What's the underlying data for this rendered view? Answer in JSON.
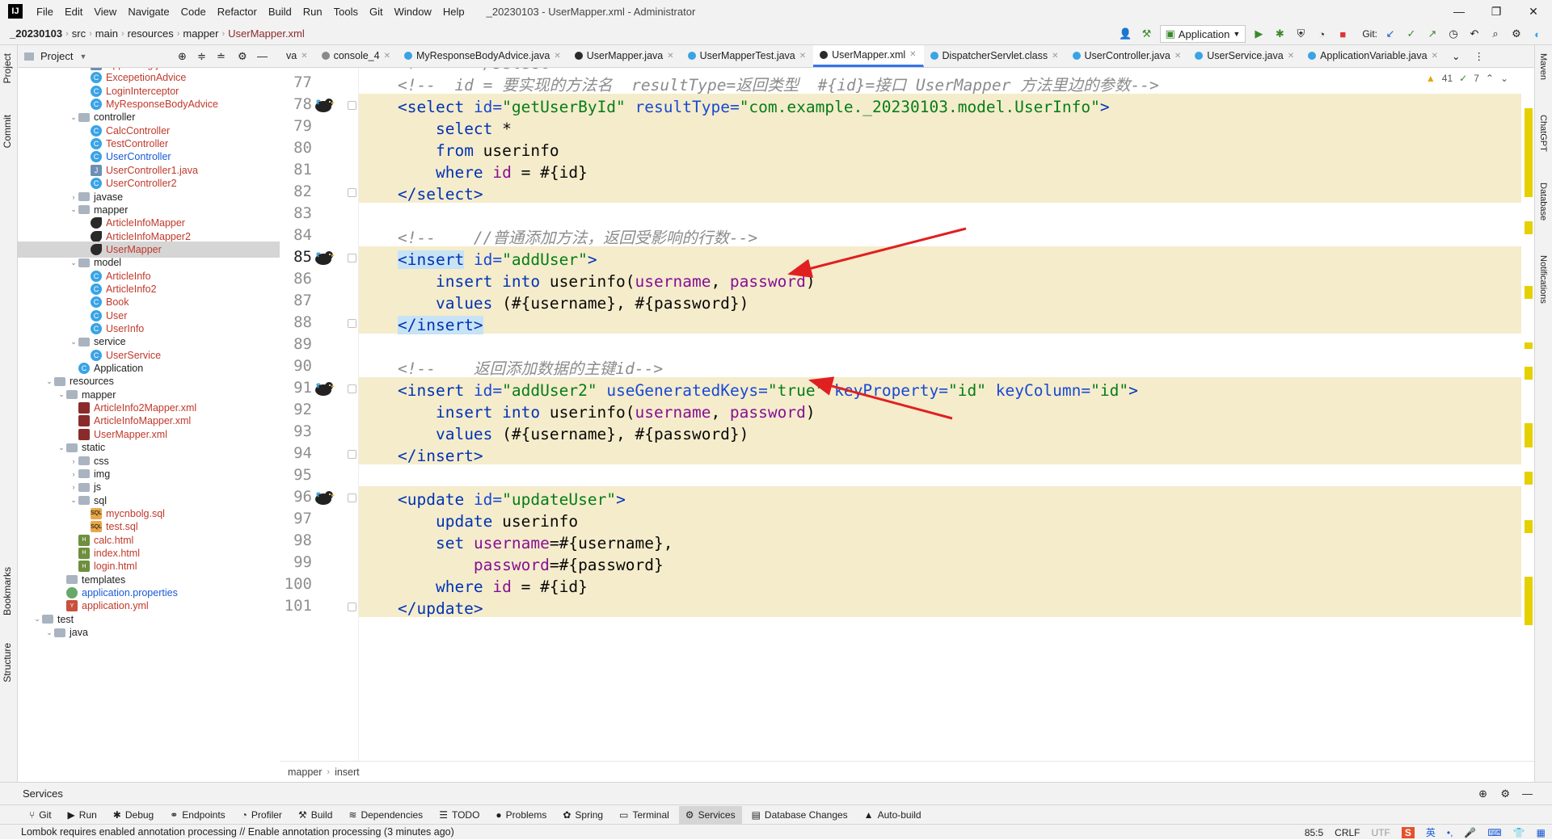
{
  "menubar": {
    "items": [
      "File",
      "Edit",
      "View",
      "Navigate",
      "Code",
      "Refactor",
      "Build",
      "Run",
      "Tools",
      "Git",
      "Window",
      "Help"
    ],
    "title": "_20230103 - UserMapper.xml - Administrator"
  },
  "breadcrumb": [
    "_20230103",
    "src",
    "main",
    "resources",
    "mapper",
    "UserMapper.xml"
  ],
  "toolbar": {
    "run_config": "Application",
    "git_label": "Git:"
  },
  "left_strip": {
    "project": "Project",
    "commit": "Commit",
    "bookmarks": "Bookmarks",
    "structure": "Structure"
  },
  "right_strip": {
    "maven": "Maven",
    "chatgpt": "ChatGPT",
    "database": "Database",
    "notifications": "Notifications"
  },
  "project_panel": {
    "title": "Project"
  },
  "tree": [
    {
      "label": "AppConfig.java",
      "icon": "jfile",
      "indent": 4,
      "color": "red"
    },
    {
      "label": "ExcepetionAdvice",
      "icon": "cls",
      "indent": 4,
      "color": "red"
    },
    {
      "label": "LoginInterceptor",
      "icon": "cls",
      "indent": 4,
      "color": "red"
    },
    {
      "label": "MyResponseBodyAdvice",
      "icon": "cls",
      "indent": 4,
      "color": "red"
    },
    {
      "label": "controller",
      "icon": "folder",
      "indent": 3,
      "chev": "v"
    },
    {
      "label": "CalcController",
      "icon": "cls",
      "indent": 4,
      "color": "red"
    },
    {
      "label": "TestController",
      "icon": "cls",
      "indent": 4,
      "color": "red"
    },
    {
      "label": "UserController",
      "icon": "cls",
      "indent": 4,
      "color": "blue"
    },
    {
      "label": "UserController1.java",
      "icon": "jfile",
      "indent": 4,
      "color": "red"
    },
    {
      "label": "UserController2",
      "icon": "cls",
      "indent": 4,
      "color": "red"
    },
    {
      "label": "javase",
      "icon": "folder",
      "indent": 3,
      "chev": ">"
    },
    {
      "label": "mapper",
      "icon": "folder",
      "indent": 3,
      "chev": "v"
    },
    {
      "label": "ArticleInfoMapper",
      "icon": "bird",
      "indent": 4,
      "color": "red"
    },
    {
      "label": "ArticleInfoMapper2",
      "icon": "bird",
      "indent": 4,
      "color": "red"
    },
    {
      "label": "UserMapper",
      "icon": "bird",
      "indent": 4,
      "color": "red",
      "selected": true
    },
    {
      "label": "model",
      "icon": "folder",
      "indent": 3,
      "chev": "v"
    },
    {
      "label": "ArticleInfo",
      "icon": "cls",
      "indent": 4,
      "color": "red"
    },
    {
      "label": "ArticleInfo2",
      "icon": "cls",
      "indent": 4,
      "color": "red"
    },
    {
      "label": "Book",
      "icon": "cls",
      "indent": 4,
      "color": "red"
    },
    {
      "label": "User",
      "icon": "cls",
      "indent": 4,
      "color": "red"
    },
    {
      "label": "UserInfo",
      "icon": "cls",
      "indent": 4,
      "color": "red"
    },
    {
      "label": "service",
      "icon": "folder",
      "indent": 3,
      "chev": "v"
    },
    {
      "label": "UserService",
      "icon": "cls",
      "indent": 4,
      "color": "red"
    },
    {
      "label": "Application",
      "icon": "app",
      "indent": 3
    },
    {
      "label": "resources",
      "icon": "folder",
      "indent": 1,
      "chev": "v"
    },
    {
      "label": "mapper",
      "icon": "folder",
      "indent": 2,
      "chev": "v"
    },
    {
      "label": "ArticleInfo2Mapper.xml",
      "icon": "xml",
      "indent": 3,
      "color": "red"
    },
    {
      "label": "ArticleInfoMapper.xml",
      "icon": "xml",
      "indent": 3,
      "color": "red"
    },
    {
      "label": "UserMapper.xml",
      "icon": "xml",
      "indent": 3,
      "color": "red"
    },
    {
      "label": "static",
      "icon": "folder",
      "indent": 2,
      "chev": "v"
    },
    {
      "label": "css",
      "icon": "folder",
      "indent": 3,
      "chev": ">"
    },
    {
      "label": "img",
      "icon": "folder",
      "indent": 3,
      "chev": ">"
    },
    {
      "label": "js",
      "icon": "folder",
      "indent": 3,
      "chev": ">"
    },
    {
      "label": "sql",
      "icon": "folder",
      "indent": 3,
      "chev": "v"
    },
    {
      "label": "mycnbolg.sql",
      "icon": "sql",
      "indent": 4,
      "color": "red"
    },
    {
      "label": "test.sql",
      "icon": "sql",
      "indent": 4,
      "color": "red"
    },
    {
      "label": "calc.html",
      "icon": "html",
      "indent": 3,
      "color": "red"
    },
    {
      "label": "index.html",
      "icon": "html",
      "indent": 3,
      "color": "red"
    },
    {
      "label": "login.html",
      "icon": "html",
      "indent": 3,
      "color": "red"
    },
    {
      "label": "templates",
      "icon": "folder",
      "indent": 2
    },
    {
      "label": "application.properties",
      "icon": "prop",
      "indent": 2,
      "color": "blue"
    },
    {
      "label": "application.yml",
      "icon": "yml",
      "indent": 2,
      "color": "red"
    },
    {
      "label": "test",
      "icon": "folder",
      "indent": 0,
      "chev": "v"
    },
    {
      "label": "java",
      "icon": "folder",
      "indent": 1,
      "chev": "v"
    }
  ],
  "tabs": [
    {
      "label": "va",
      "dot": ""
    },
    {
      "label": "console_4",
      "dot": "#8a8a8a"
    },
    {
      "label": "MyResponseBodyAdvice.java",
      "dot": "#39a3e6"
    },
    {
      "label": "UserMapper.java",
      "dot": "#2a2a2a"
    },
    {
      "label": "UserMapperTest.java",
      "dot": "#39a3e6"
    },
    {
      "label": "UserMapper.xml",
      "dot": "#2a2a2a",
      "active": true
    },
    {
      "label": "DispatcherServlet.class",
      "dot": "#39a3e6"
    },
    {
      "label": "UserController.java",
      "dot": "#39a3e6"
    },
    {
      "label": "UserService.java",
      "dot": "#39a3e6"
    },
    {
      "label": "ApplicationVariable.java",
      "dot": "#39a3e6"
    }
  ],
  "inspections": {
    "warnings": "41",
    "ok": "7"
  },
  "code": [
    {
      "n": "76",
      "html": "<span class='cm'>&lt;!--    &lt;/select&gt;--&gt;</span>"
    },
    {
      "n": "77",
      "html": "<span class='cm'>&lt;!--  id = 要实现的方法名  resultType=返回类型  #{id}=接口 UserMapper 方法里边的参数--&gt;</span>"
    },
    {
      "n": "78",
      "html": "<span class='tg'>&lt;select</span> <span class='at'>id=</span><span class='vl'>\"getUserById\"</span> <span class='at'>resultType=</span><span class='vl'>\"com.example._20230103.model.UserInfo\"</span><span class='tg'>&gt;</span>",
      "bird": true,
      "hl": true
    },
    {
      "n": "79",
      "html": "    <span class='kw'>select</span> *",
      "hl": true
    },
    {
      "n": "80",
      "html": "    <span class='kw'>from</span> userinfo",
      "hl": true
    },
    {
      "n": "81",
      "html": "    <span class='kw'>where</span> <span class='pm'>id</span> = #{id}",
      "hl": true
    },
    {
      "n": "82",
      "html": "<span class='tg'>&lt;/select&gt;</span>",
      "hl": true
    },
    {
      "n": "83",
      "html": ""
    },
    {
      "n": "84",
      "html": "<span class='cm'>&lt;!--    //普通添加方法，返回受影响的行数--&gt;</span>"
    },
    {
      "n": "85",
      "html": "<span class='tg tgsel'>&lt;insert</span> <span class='at'>id=</span><span class='vl'>\"addUser\"</span><span class='tg'>&gt;</span>",
      "bird": true,
      "hl": true,
      "cur": true
    },
    {
      "n": "86",
      "html": "    <span class='kw'>insert into</span> userinfo(<span class='pm'>username</span>, <span class='pm'>password</span>)",
      "hl": true
    },
    {
      "n": "87",
      "html": "    <span class='kw'>values</span> (#{username}, #{password})",
      "hl": true
    },
    {
      "n": "88",
      "html": "<span class='tg tgsel'>&lt;/insert&gt;</span>",
      "hl": true
    },
    {
      "n": "89",
      "html": ""
    },
    {
      "n": "90",
      "html": "<span class='cm'>&lt;!--    返回添加数据的主键id--&gt;</span>"
    },
    {
      "n": "91",
      "html": "<span class='tg'>&lt;insert</span> <span class='at'>id=</span><span class='vl'>\"addUser2\"</span> <span class='at'>useGeneratedKeys=</span><span class='vl'>\"true\"</span> <span class='at'>keyProperty=</span><span class='vl'>\"id\"</span> <span class='at'>keyColumn=</span><span class='vl'>\"id\"</span><span class='tg'>&gt;</span>",
      "bird": true,
      "hl": true
    },
    {
      "n": "92",
      "html": "    <span class='kw'>insert into</span> userinfo(<span class='pm'>username</span>, <span class='pm'>password</span>)",
      "hl": true
    },
    {
      "n": "93",
      "html": "    <span class='kw'>values</span> (#{username}, #{password})",
      "hl": true
    },
    {
      "n": "94",
      "html": "<span class='tg'>&lt;/insert&gt;</span>",
      "hl": true
    },
    {
      "n": "95",
      "html": ""
    },
    {
      "n": "96",
      "html": "<span class='tg'>&lt;update</span> <span class='at'>id=</span><span class='vl'>\"updateUser\"</span><span class='tg'>&gt;</span>",
      "bird": true,
      "hl": true
    },
    {
      "n": "97",
      "html": "    <span class='kw'>update</span> userinfo",
      "hl": true
    },
    {
      "n": "98",
      "html": "    <span class='kw'>set</span> <span class='pm'>username</span>=#{username},",
      "hl": true
    },
    {
      "n": "99",
      "html": "        <span class='pm'>password</span>=#{password}",
      "hl": true
    },
    {
      "n": "100",
      "html": "    <span class='kw'>where</span> <span class='pm'>id</span> = #{id}",
      "hl": true
    },
    {
      "n": "101",
      "html": "<span class='tg'>&lt;/update&gt;</span>",
      "hl": true
    }
  ],
  "editor_breadcrumb": [
    "mapper",
    "insert"
  ],
  "services_title": "Services",
  "tool_windows": [
    {
      "label": "Git",
      "icon": "⑂"
    },
    {
      "label": "Run",
      "icon": "▶"
    },
    {
      "label": "Debug",
      "icon": "✱"
    },
    {
      "label": "Endpoints",
      "icon": "⚭"
    },
    {
      "label": "Profiler",
      "icon": "◔"
    },
    {
      "label": "Build",
      "icon": "⚒"
    },
    {
      "label": "Dependencies",
      "icon": "≋"
    },
    {
      "label": "TODO",
      "icon": "☰"
    },
    {
      "label": "Problems",
      "icon": "●"
    },
    {
      "label": "Spring",
      "icon": "✿"
    },
    {
      "label": "Terminal",
      "icon": "▭"
    },
    {
      "label": "Services",
      "icon": "⚙",
      "active": true
    },
    {
      "label": "Database Changes",
      "icon": "▤"
    },
    {
      "label": "Auto-build",
      "icon": "▲"
    }
  ],
  "status": {
    "message": "Lombok requires enabled annotation processing // Enable annotation processing (3 minutes ago)",
    "position": "85:5",
    "line_sep": "CRLF",
    "encoding": "UTF"
  },
  "colors": {
    "accent": "#3574f0",
    "highlight": "#f5eccc",
    "arrow": "#e02020"
  }
}
